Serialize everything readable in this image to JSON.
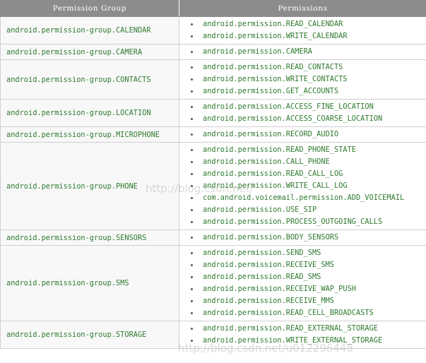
{
  "table": {
    "headers": [
      "Permission Group",
      "Permissions"
    ],
    "rows": [
      {
        "group": "android.permission-group.CALENDAR",
        "permissions": [
          "android.permission.READ_CALENDAR",
          "android.permission.WRITE_CALENDAR"
        ]
      },
      {
        "group": "android.permission-group.CAMERA",
        "permissions": [
          "android.permission.CAMERA"
        ]
      },
      {
        "group": "android.permission-group.CONTACTS",
        "permissions": [
          "android.permission.READ_CONTACTS",
          "android.permission.WRITE_CONTACTS",
          "android.permission.GET_ACCOUNTS"
        ]
      },
      {
        "group": "android.permission-group.LOCATION",
        "permissions": [
          "android.permission.ACCESS_FINE_LOCATION",
          "android.permission.ACCESS_COARSE_LOCATION"
        ]
      },
      {
        "group": "android.permission-group.MICROPHONE",
        "permissions": [
          "android.permission.RECORD_AUDIO"
        ]
      },
      {
        "group": "android.permission-group.PHONE",
        "permissions": [
          "android.permission.READ_PHONE_STATE",
          "android.permission.CALL_PHONE",
          "android.permission.READ_CALL_LOG",
          "android.permission.WRITE_CALL_LOG",
          "com.android.voicemail.permission.ADD_VOICEMAIL",
          "android.permission.USE_SIP",
          "android.permission.PROCESS_OUTGOING_CALLS"
        ]
      },
      {
        "group": "android.permission-group.SENSORS",
        "permissions": [
          "android.permission.BODY_SENSORS"
        ]
      },
      {
        "group": "android.permission-group.SMS",
        "permissions": [
          "android.permission.SEND_SMS",
          "android.permission.RECEIVE_SMS",
          "android.permission.READ_SMS",
          "android.permission.RECEIVE_WAP_PUSH",
          "android.permission.RECEIVE_MMS",
          "android.permission.READ_CELL_BROADCASTS"
        ]
      },
      {
        "group": "android.permission-group.STORAGE",
        "permissions": [
          "android.permission.READ_EXTERNAL_STORAGE",
          "android.permission.WRITE_EXTERNAL_STORAGE"
        ]
      }
    ]
  },
  "watermarks": [
    "http://blog.csdn.net/",
    "http://blog.csdn.net/u012296448"
  ],
  "colors": {
    "header_bg": "#8c8c8c",
    "text_green": "#2f7a2f",
    "border": "#cfcfcf",
    "group_cell_bg": "#f8f8f8"
  }
}
